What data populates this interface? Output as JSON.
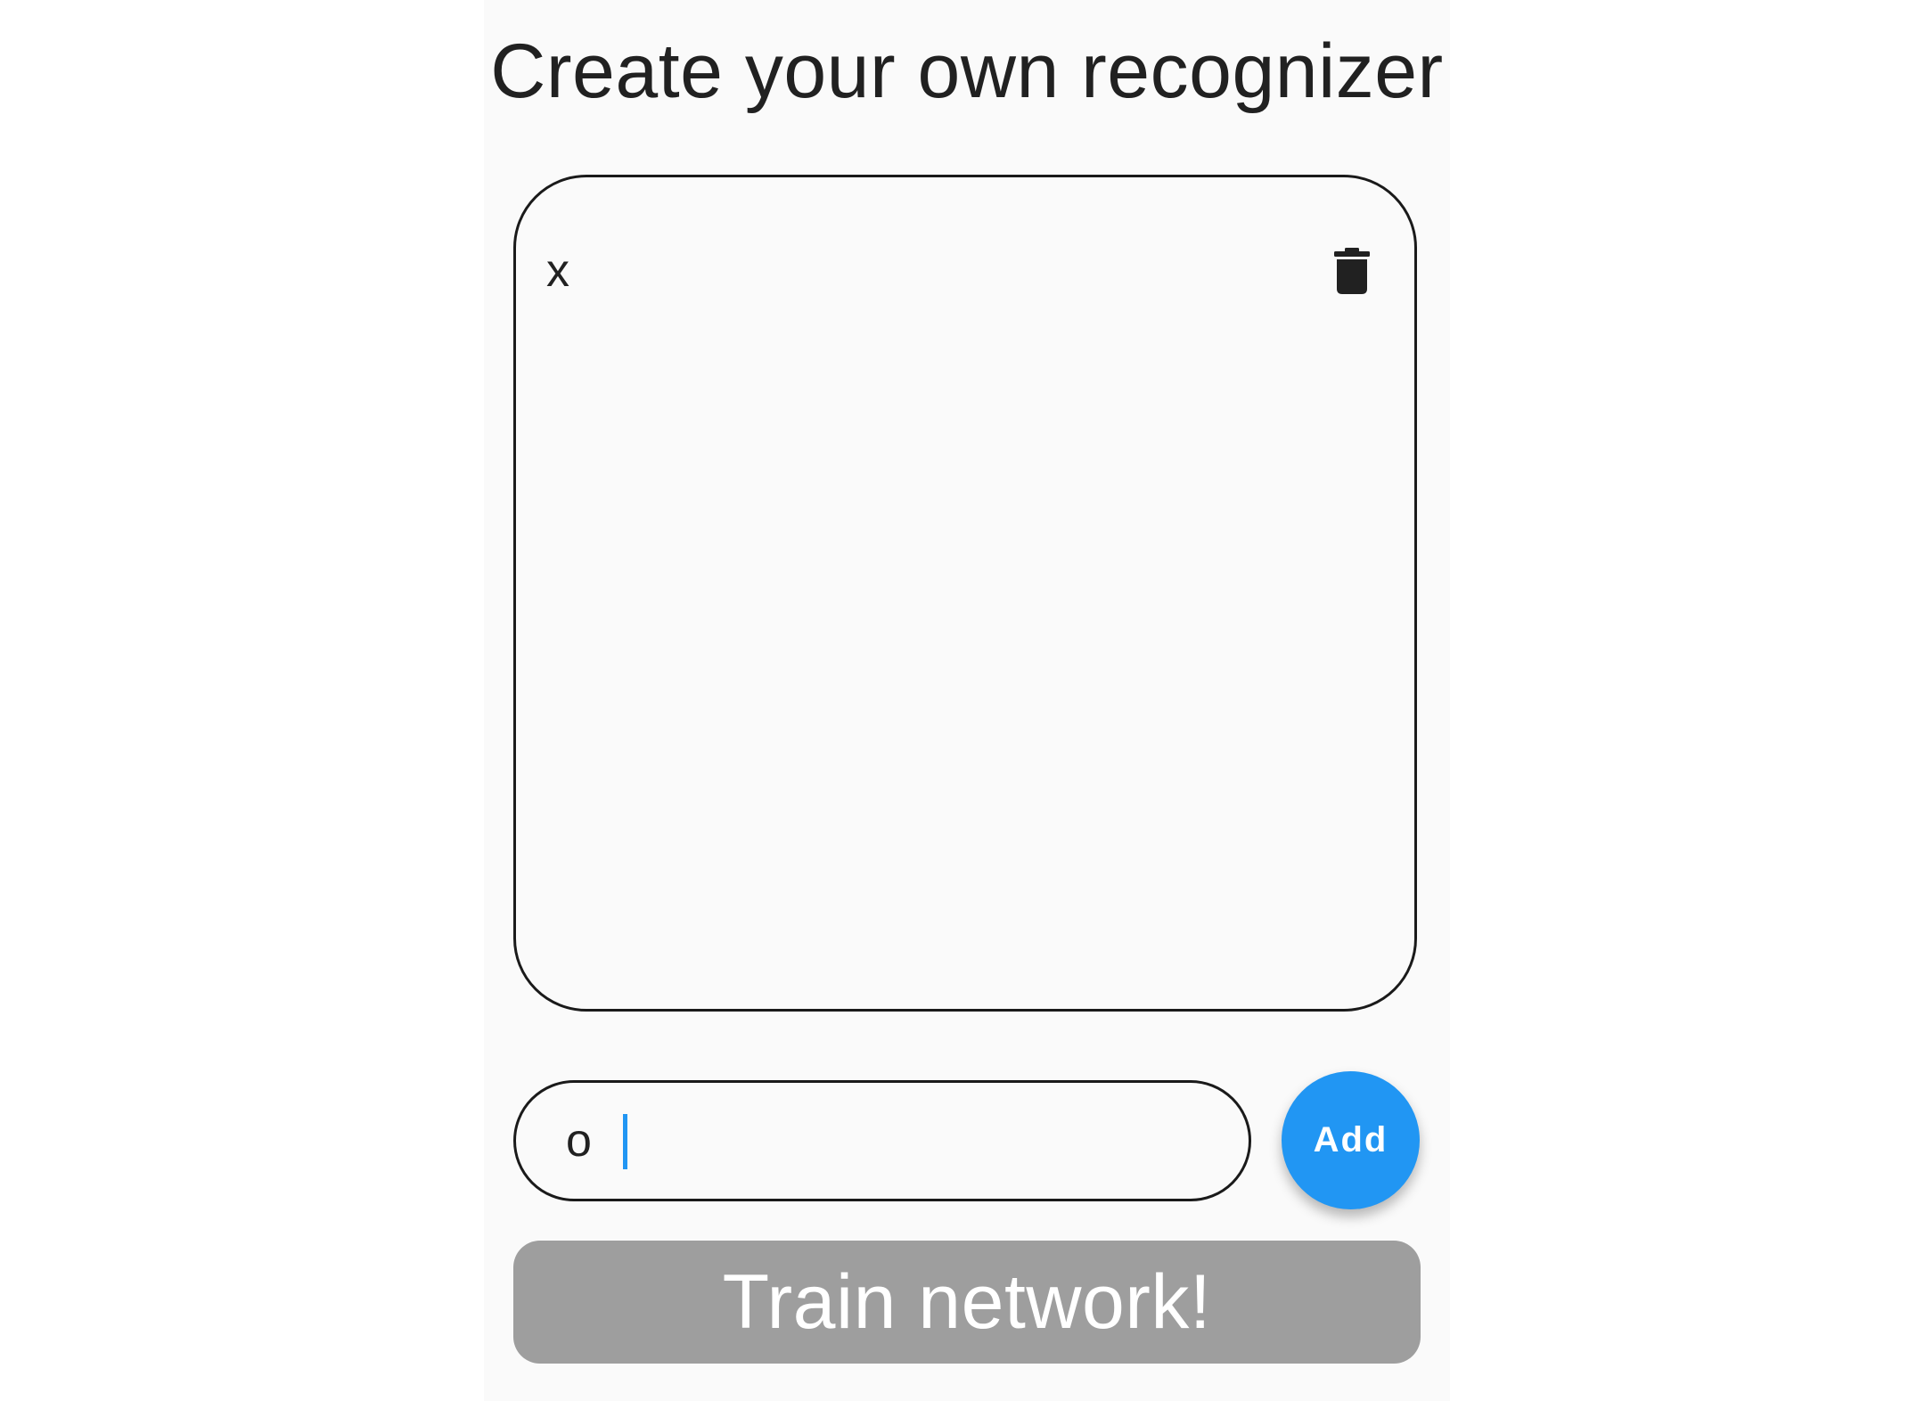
{
  "page": {
    "title": "Create your own recognizer"
  },
  "labels": {
    "items": [
      {
        "text": "x",
        "delete_icon": "trash-icon"
      }
    ]
  },
  "input": {
    "value": "o",
    "placeholder": ""
  },
  "actions": {
    "add_label": "Add",
    "train_label": "Train network!"
  },
  "colors": {
    "accent": "#2196f3",
    "disabled_button": "#9e9e9e",
    "background": "#fafafa",
    "text": "#212121"
  }
}
